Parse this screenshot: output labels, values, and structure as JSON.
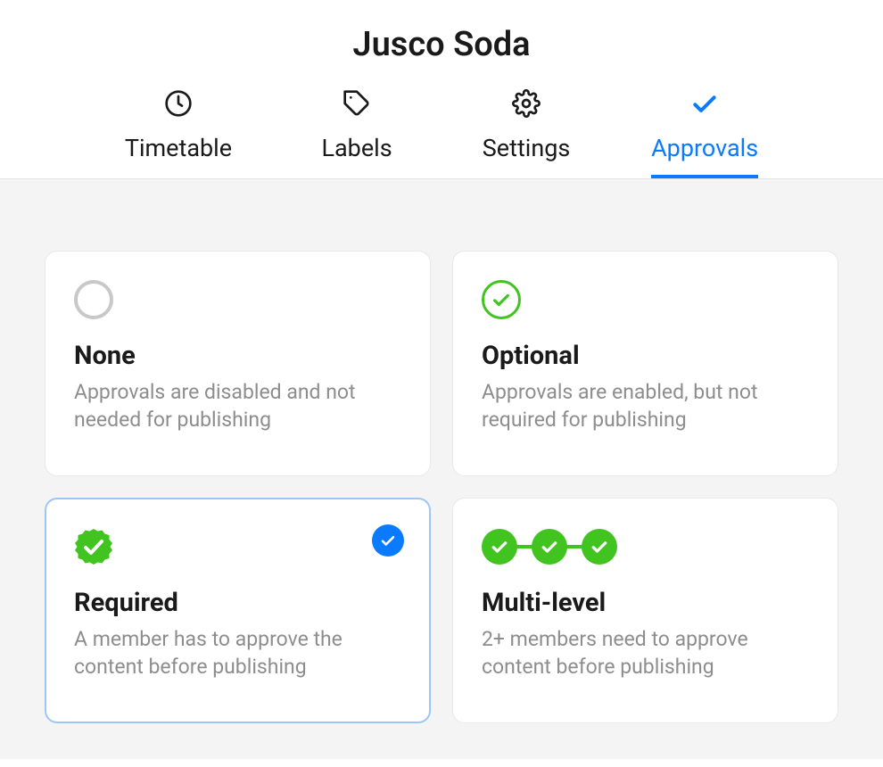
{
  "page": {
    "title": "Jusco Soda"
  },
  "tabs": [
    {
      "label": "Timetable",
      "icon": "clock-icon",
      "active": false
    },
    {
      "label": "Labels",
      "icon": "tag-icon",
      "active": false
    },
    {
      "label": "Settings",
      "icon": "gear-icon",
      "active": false
    },
    {
      "label": "Approvals",
      "icon": "check-icon",
      "active": true
    }
  ],
  "options": [
    {
      "title": "None",
      "desc": "Approvals are disabled and not needed for publishing",
      "icon": "none-icon",
      "selected": false
    },
    {
      "title": "Optional",
      "desc": "Approvals are enabled, but not required for publishing",
      "icon": "optional-icon",
      "selected": false
    },
    {
      "title": "Required",
      "desc": "A member has to approve the content before publishing",
      "icon": "required-icon",
      "selected": true
    },
    {
      "title": "Multi-level",
      "desc": "2+ members need to approve content before publishing",
      "icon": "multilevel-icon",
      "selected": false
    }
  ]
}
